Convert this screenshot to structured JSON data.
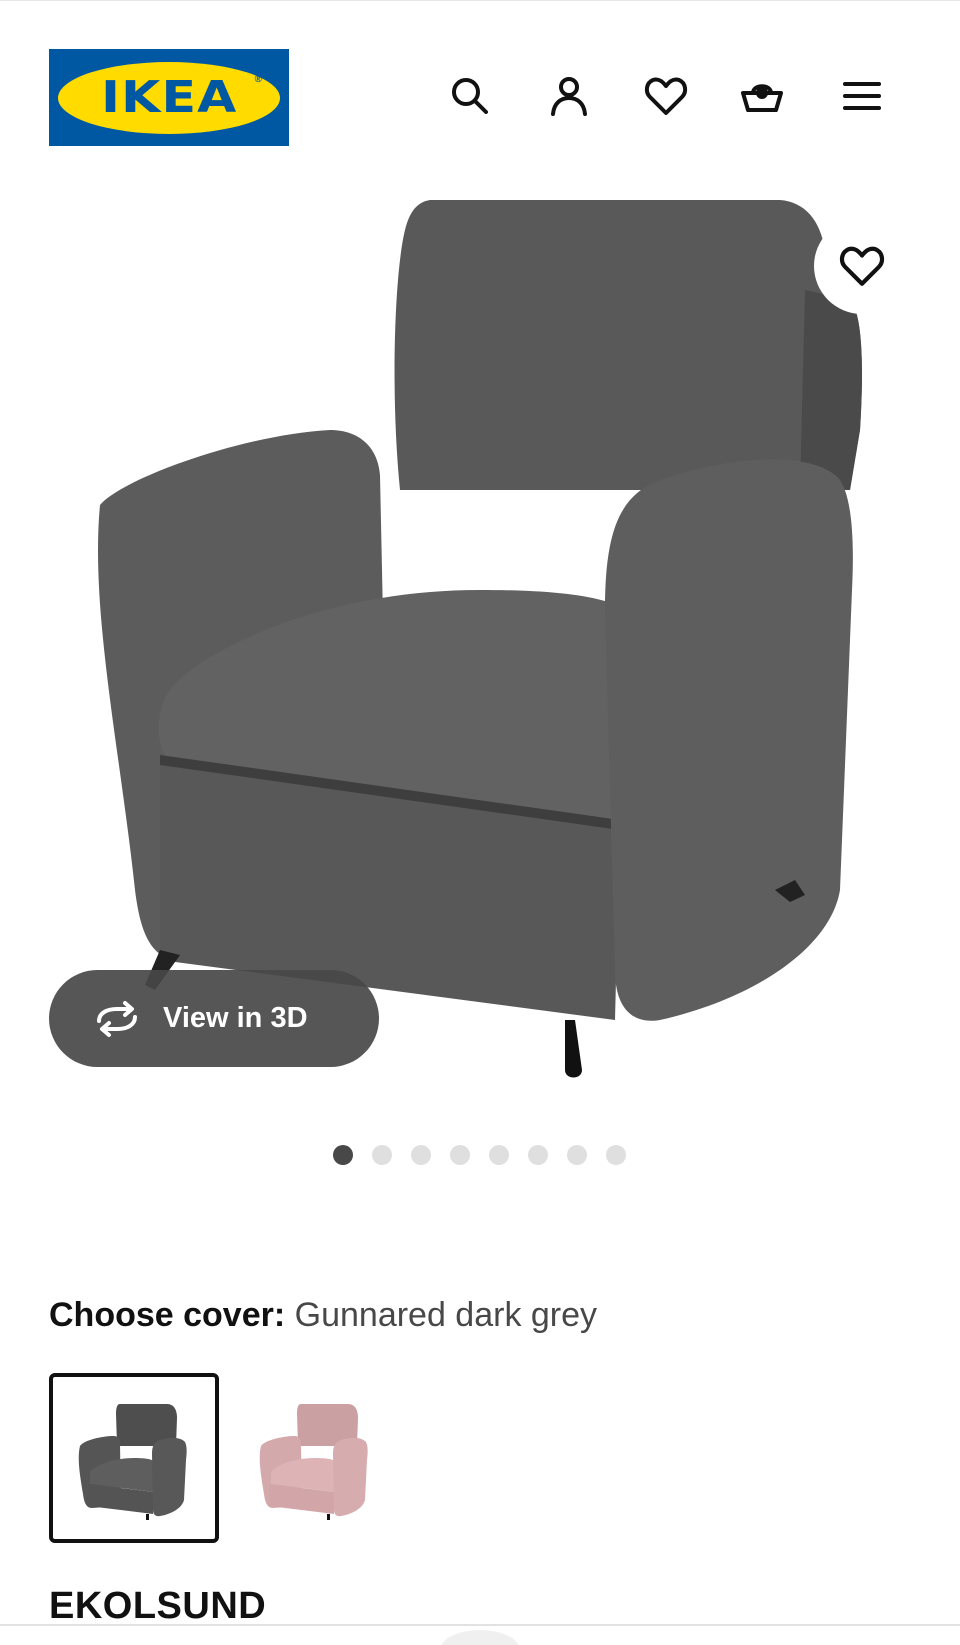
{
  "header": {
    "logo_text": "IKEA",
    "logo_reg": "®",
    "icons": [
      "search-icon",
      "account-icon",
      "favourites-icon",
      "shopping-bag-icon",
      "menu-icon"
    ]
  },
  "hero": {
    "image_subject": "armchair-image",
    "view_3d_label": "View in 3D",
    "carousel": {
      "total": 8,
      "active": 1
    }
  },
  "cover": {
    "label": "Choose cover:",
    "value": "Gunnared dark grey",
    "options": [
      {
        "name": "Gunnared dark grey",
        "color": "#555555",
        "selected": true
      },
      {
        "name": "pink",
        "color": "#d9a6a9",
        "selected": false
      }
    ]
  },
  "product": {
    "name": "EKOLSUND"
  },
  "colors": {
    "brand_blue": "#0058a3",
    "brand_yellow": "#ffdb00",
    "chair_grey": "#5a5a5a",
    "dot_active": "#484848",
    "dot_inactive": "#dfdfdf"
  }
}
